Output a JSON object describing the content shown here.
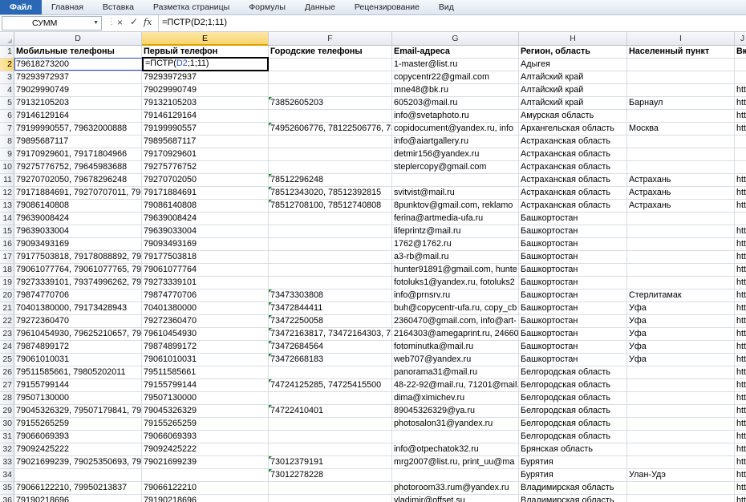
{
  "ribbon": {
    "tabs": [
      "Файл",
      "Главная",
      "Вставка",
      "Разметка страницы",
      "Формулы",
      "Данные",
      "Рецензирование",
      "Вид"
    ]
  },
  "formula_bar": {
    "name_box": "СУММ",
    "cancel_icon": "×",
    "enter_icon": "✓",
    "fx_label": "fx",
    "formula": "=ПСТР(D2;1;11)"
  },
  "active_cell": {
    "prefix": "=ПСТР(",
    "ref": "D2",
    "suffix": ";1;11)"
  },
  "columns": [
    "D",
    "E",
    "F",
    "G",
    "H",
    "I",
    "J"
  ],
  "headers": {
    "D": "Мобильные телефоны",
    "E": "Первый телефон",
    "F": "Городские телефоны",
    "G": "Email-адреса",
    "H": "Регион, область",
    "I": "Населенный пункт",
    "J": "Вк"
  },
  "rows": [
    {
      "n": "2",
      "D": "79618273200",
      "E": "",
      "F": "",
      "G": "1-master@list.ru",
      "H": "Адыгея",
      "I": "",
      "J": ""
    },
    {
      "n": "3",
      "D": "79293972937",
      "E": "79293972937",
      "F": "",
      "G": "copycentr22@gmail.com",
      "H": "Алтайский край",
      "I": "",
      "J": ""
    },
    {
      "n": "4",
      "D": "79029990749",
      "E": "79029990749",
      "F": "",
      "G": "mne48@bk.ru",
      "H": "Алтайский край",
      "I": "",
      "J": "htt"
    },
    {
      "n": "5",
      "D": "79132105203",
      "E": "79132105203",
      "F": "73852605203",
      "G": "605203@mail.ru",
      "H": "Алтайский край",
      "I": "Барнаул",
      "J": "htt"
    },
    {
      "n": "6",
      "D": "79146129164",
      "E": "79146129164",
      "F": "",
      "G": "info@svetaphoto.ru",
      "H": "Амурская область",
      "I": "",
      "J": "htt"
    },
    {
      "n": "7",
      "D": "79199990557, 79632000888",
      "E": "79199990557",
      "F": "74952606776, 78122506776, 7812",
      "G": "copidocument@yandex.ru, info",
      "H": "Архангельская область",
      "I": "Москва",
      "J": "htt"
    },
    {
      "n": "8",
      "D": "79895687117",
      "E": "79895687117",
      "F": "",
      "G": "info@aiartgallery.ru",
      "H": "Астраханская область",
      "I": "",
      "J": ""
    },
    {
      "n": "9",
      "D": "79170929601, 79171804966",
      "E": "79170929601",
      "F": "",
      "G": "detmir156@yandex.ru",
      "H": "Астраханская область",
      "I": "",
      "J": ""
    },
    {
      "n": "10",
      "D": "79275776752, 79645983688",
      "E": "79275776752",
      "F": "",
      "G": "steplercopy@gmail.com",
      "H": "Астраханская область",
      "I": "",
      "J": ""
    },
    {
      "n": "11",
      "D": "79270702050, 79678296248",
      "E": "79270702050",
      "F": "78512296248",
      "G": "",
      "H": "Астраханская область",
      "I": "Астрахань",
      "J": "htt"
    },
    {
      "n": "12",
      "D": "79171884691, 79270707011, 7960",
      "E": "79171884691",
      "F": "78512343020, 78512392815",
      "G": "svitvist@mail.ru",
      "H": "Астраханская область",
      "I": "Астрахань",
      "J": "htt"
    },
    {
      "n": "13",
      "D": "79086140808",
      "E": "79086140808",
      "F": "78512708100, 78512740808",
      "G": "8punktov@gmail.com, reklamo",
      "H": "Астраханская область",
      "I": "Астрахань",
      "J": "htt"
    },
    {
      "n": "14",
      "D": "79639008424",
      "E": "79639008424",
      "F": "",
      "G": "ferina@artmedia-ufa.ru",
      "H": "Башкортостан",
      "I": "",
      "J": ""
    },
    {
      "n": "15",
      "D": "79639033004",
      "E": "79639033004",
      "F": "",
      "G": "lifeprintz@mail.ru",
      "H": "Башкортостан",
      "I": "",
      "J": "htt"
    },
    {
      "n": "16",
      "D": "79093493169",
      "E": "79093493169",
      "F": "",
      "G": "1762@1762.ru",
      "H": "Башкортостан",
      "I": "",
      "J": "htt"
    },
    {
      "n": "17",
      "D": "79177503818, 79178088892, 7917",
      "E": "79177503818",
      "F": "",
      "G": "a3-rb@mail.ru",
      "H": "Башкортостан",
      "I": "",
      "J": "htt"
    },
    {
      "n": "18",
      "D": "79061077764, 79061077765, 7987",
      "E": "79061077764",
      "F": "",
      "G": "hunter91891@gmail.com, hunte",
      "H": "Башкортостан",
      "I": "",
      "J": "htt"
    },
    {
      "n": "19",
      "D": "79273339101, 79374996262, 7960",
      "E": "79273339101",
      "F": "",
      "G": "fotoluks1@yandex.ru, fotoluks2",
      "H": "Башкортостан",
      "I": "",
      "J": "htt"
    },
    {
      "n": "20",
      "D": "79874770706",
      "E": "79874770706",
      "F": "73473303808",
      "G": "info@prnsrv.ru",
      "H": "Башкортостан",
      "I": "Стерлитамак",
      "J": "htt"
    },
    {
      "n": "21",
      "D": "70401380000, 79173428943",
      "E": "70401380000",
      "F": "73472844411",
      "G": "buh@copycentr-ufa.ru, copy_cb",
      "H": "Башкортостан",
      "I": "Уфа",
      "J": "htt"
    },
    {
      "n": "22",
      "D": "79272360470",
      "E": "79272360470",
      "F": "73472250058",
      "G": "2360470@gmail.com, info@art-",
      "H": "Башкортостан",
      "I": "Уфа",
      "J": "htt"
    },
    {
      "n": "23",
      "D": "79610454930, 79625210657, 7962",
      "E": "79610454930",
      "F": "73472163817, 73472164303, 7347",
      "G": "2164303@amegaprint.ru, 24660",
      "H": "Башкортостан",
      "I": "Уфа",
      "J": "htt"
    },
    {
      "n": "24",
      "D": "79874899172",
      "E": "79874899172",
      "F": "73472684564",
      "G": "fotominutka@mail.ru",
      "H": "Башкортостан",
      "I": "Уфа",
      "J": "htt"
    },
    {
      "n": "25",
      "D": "79061010031",
      "E": "79061010031",
      "F": "73472668183",
      "G": "web707@yandex.ru",
      "H": "Башкортостан",
      "I": "Уфа",
      "J": "htt"
    },
    {
      "n": "26",
      "D": "79511585661, 79805202011",
      "E": "79511585661",
      "F": "",
      "G": "panorama31@mail.ru",
      "H": "Белгородская область",
      "I": "",
      "J": "htt"
    },
    {
      "n": "27",
      "D": "79155799144",
      "E": "79155799144",
      "F": "74724125285, 74725415500",
      "G": "48-22-92@mail.ru, 71201@mail.",
      "H": "Белгородская область",
      "I": "",
      "J": "htt"
    },
    {
      "n": "28",
      "D": "79507130000",
      "E": "79507130000",
      "F": "",
      "G": "dima@ximichev.ru",
      "H": "Белгородская область",
      "I": "",
      "J": "htt"
    },
    {
      "n": "29",
      "D": "79045326329, 79507179841, 7950",
      "E": "79045326329",
      "F": "74722410401",
      "G": "89045326329@ya.ru",
      "H": "Белгородская область",
      "I": "",
      "J": "htt"
    },
    {
      "n": "30",
      "D": "79155265259",
      "E": "79155265259",
      "F": "",
      "G": "photosalon31@yandex.ru",
      "H": "Белгородская область",
      "I": "",
      "J": "htt"
    },
    {
      "n": "31",
      "D": "79066069393",
      "E": "79066069393",
      "F": "",
      "G": "",
      "H": "Белгородская область",
      "I": "",
      "J": "htt"
    },
    {
      "n": "32",
      "D": "79092425222",
      "E": "79092425222",
      "F": "",
      "G": "info@otpechatok32.ru",
      "H": "Брянская область",
      "I": "",
      "J": "htt"
    },
    {
      "n": "33",
      "D": "79021699239, 79025350693, 7902",
      "E": "79021699239",
      "F": "73012379191",
      "G": "mrg2007@list.ru, print_uu@ma",
      "H": "Бурятия",
      "I": "",
      "J": "htt"
    },
    {
      "n": "34",
      "D": "",
      "E": "",
      "F": "73012278228",
      "G": "",
      "H": "Бурятия",
      "I": "Улан-Удэ",
      "J": "htt"
    },
    {
      "n": "35",
      "D": "79066122210, 79950213837",
      "E": "79066122210",
      "F": "",
      "G": "photoroom33.rum@yandex.ru",
      "H": "Владимирская область",
      "I": "",
      "J": "htt"
    },
    {
      "n": "36",
      "D": "79190218696",
      "E": "79190218696",
      "F": "",
      "G": "vladimir@offset.su",
      "H": "Владимирская область",
      "I": "",
      "J": "htt"
    }
  ]
}
